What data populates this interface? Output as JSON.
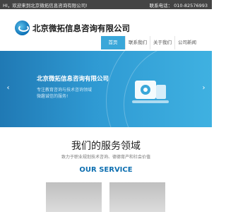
{
  "topbar": {
    "welcome": "HI，欢迎来到北京微拓信息咨询有限公司!",
    "hotline": "联系电话： 010-82576993"
  },
  "header": {
    "company_name": "北京微拓信息咨询有限公司",
    "logo_icon": "company-logo-icon"
  },
  "nav": {
    "items": [
      "首页",
      "联系我们",
      "关于我们",
      "公司新闻"
    ],
    "active_index": 0,
    "active_color": "#3aa7d9"
  },
  "banner": {
    "title": "北京微拓信息咨询有限公司",
    "lines": [
      "专注教育咨询与技术咨询领域",
      "微趣诚信的服务!"
    ],
    "colors": {
      "start": "#2079b4",
      "end": "#3fb1e1"
    }
  },
  "services": {
    "title": "我们的服务领域",
    "subtitle": "致力于职业规划技术咨询、德德育产和社会价值",
    "title_en": "OUR SERVICE"
  },
  "colors": {
    "topbar_bg": "#444444",
    "accent": "#0e6fb0"
  }
}
